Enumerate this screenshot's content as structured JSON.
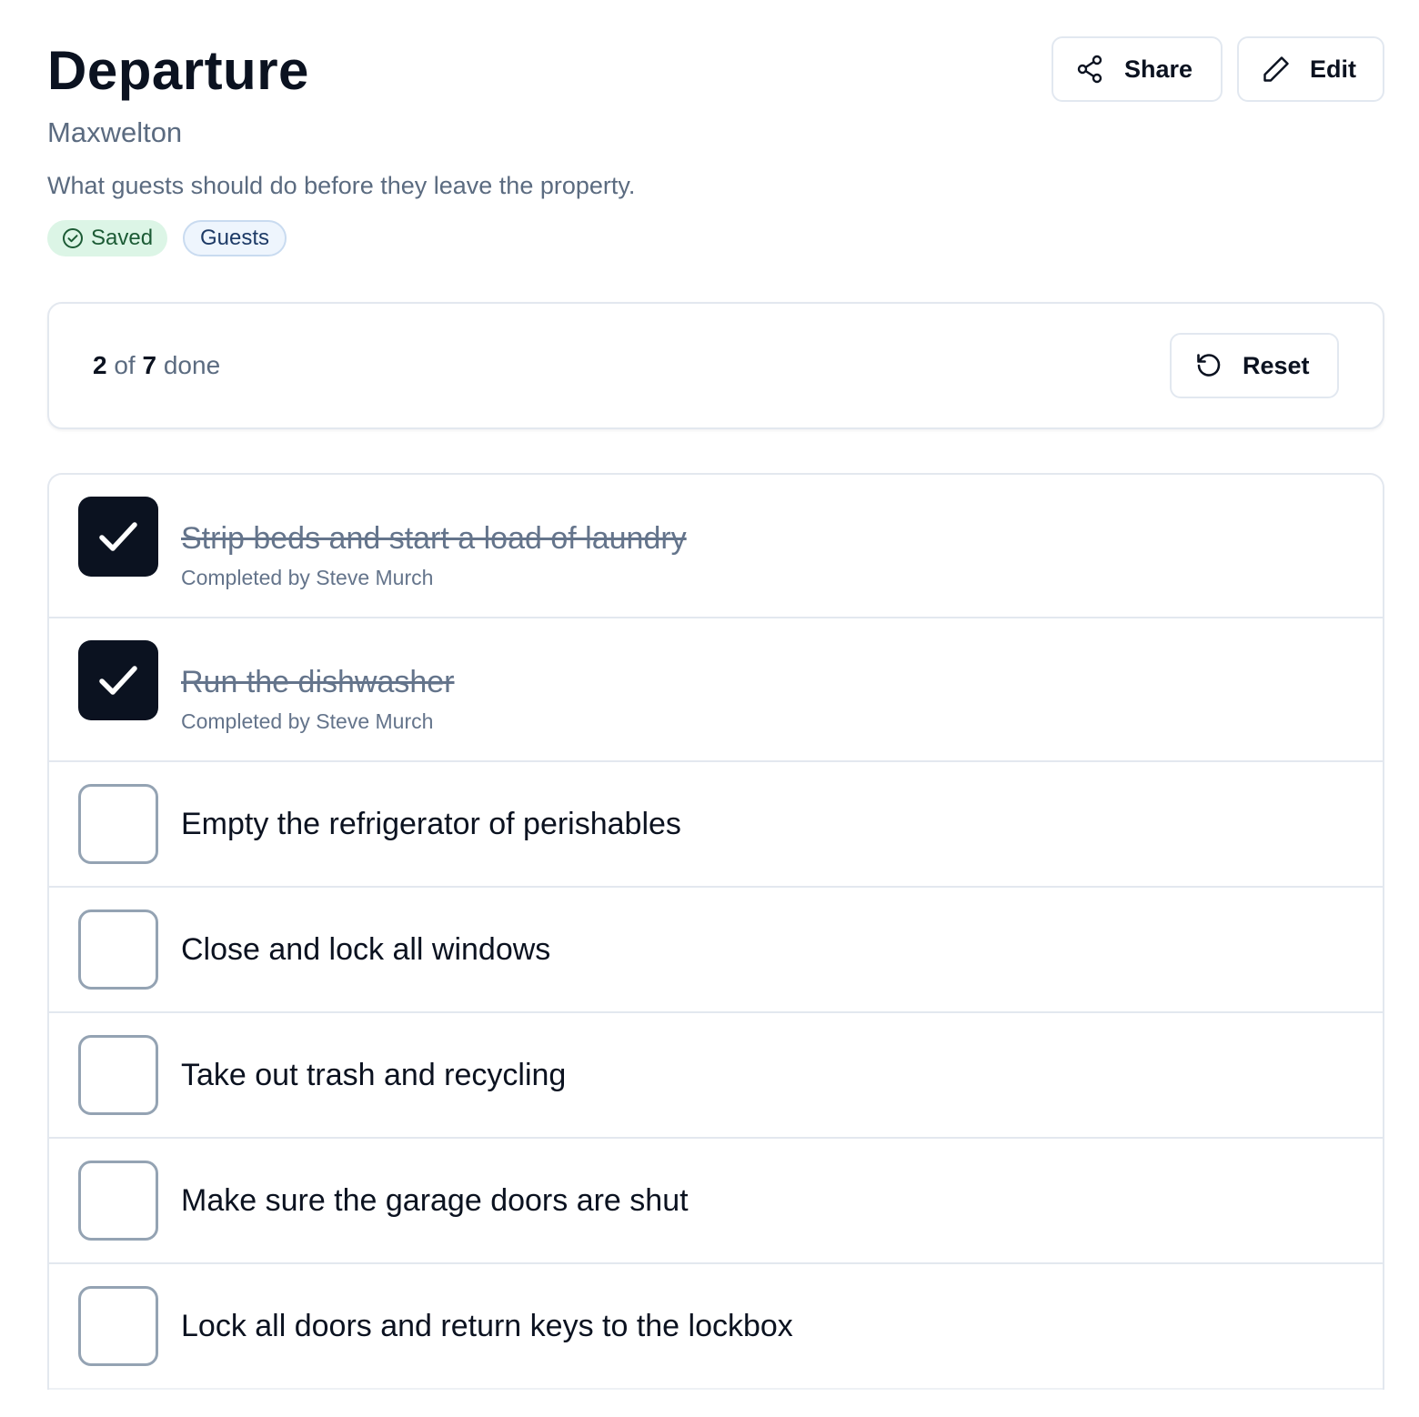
{
  "header": {
    "title": "Departure",
    "subtitle": "Maxwelton",
    "description": "What guests should do before they leave the property.",
    "tags": {
      "saved": "Saved",
      "guests": "Guests"
    },
    "actions": {
      "share_label": "Share",
      "edit_label": "Edit"
    }
  },
  "progress": {
    "done_count": "2",
    "of_label": "of",
    "total_count": "7",
    "done_label": "done",
    "reset_label": "Reset"
  },
  "checklist": {
    "items": [
      {
        "label": "Strip beds and start a load of laundry",
        "checked": true,
        "meta": "Completed by Steve Murch"
      },
      {
        "label": "Run the dishwasher",
        "checked": true,
        "meta": "Completed by Steve Murch"
      },
      {
        "label": "Empty the refrigerator of perishables",
        "checked": false
      },
      {
        "label": "Close and lock all windows",
        "checked": false
      },
      {
        "label": "Take out trash and recycling",
        "checked": false
      },
      {
        "label": "Make sure the garage doors are shut",
        "checked": false
      },
      {
        "label": "Lock all doors and return keys to the lockbox",
        "checked": false
      }
    ]
  },
  "colors": {
    "text_primary": "#0b1220",
    "text_muted": "#5b6b80",
    "saved_bg": "#dcf5e6",
    "saved_text": "#1c5b35",
    "guests_bg": "#eef5fd",
    "border": "#e3e8ef",
    "checkbox_checked": "#0b1220",
    "checkbox_unchecked_border": "#94a3b3"
  },
  "icons": {
    "share": "share-icon",
    "edit": "pencil-icon",
    "reset": "reset-icon",
    "saved": "check-circle-icon",
    "checkmark": "checkmark-icon"
  }
}
